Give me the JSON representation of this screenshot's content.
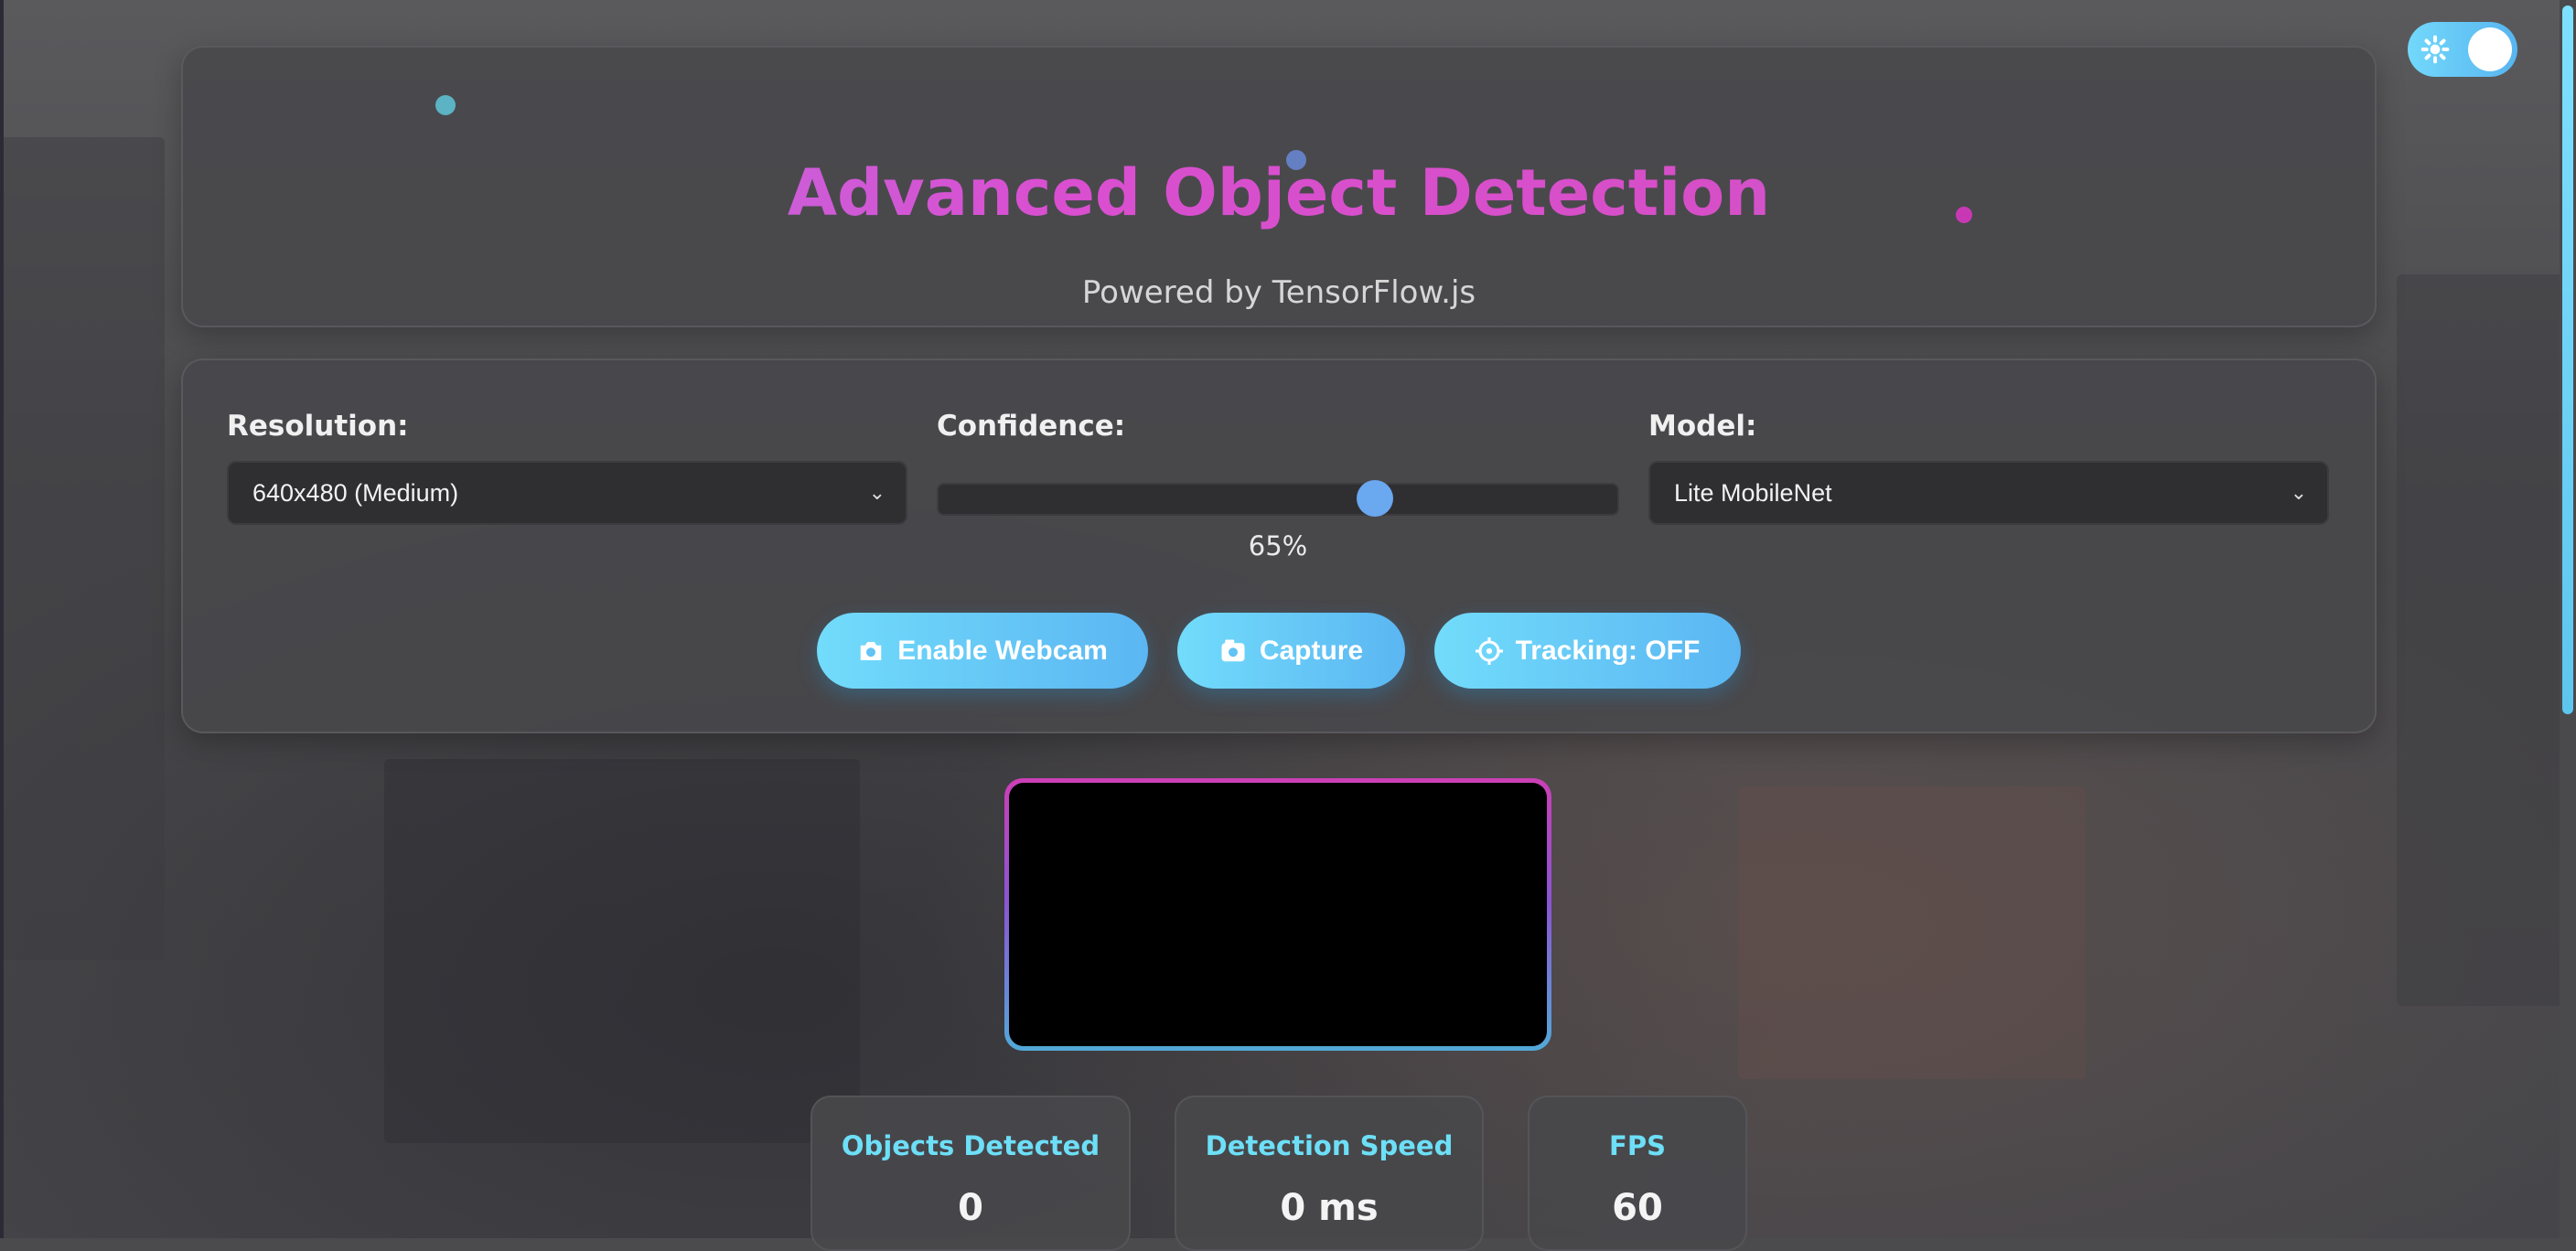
{
  "header": {
    "title": "Advanced Object Detection",
    "subtitle": "Powered by TensorFlow.js"
  },
  "controls": {
    "resolution": {
      "label": "Resolution:",
      "value": "640x480 (Medium)"
    },
    "confidence": {
      "label": "Confidence:",
      "value_text": "65%",
      "value": 0.65
    },
    "model": {
      "label": "Model:",
      "value": "Lite MobileNet"
    }
  },
  "buttons": {
    "webcam": "Enable Webcam",
    "capture": "Capture",
    "tracking": "Tracking: OFF"
  },
  "stats": [
    {
      "label": "Objects Detected",
      "value": "0"
    },
    {
      "label": "Detection Speed",
      "value": "0 ms"
    },
    {
      "label": "FPS",
      "value": "60"
    }
  ],
  "theme_toggle": {
    "state": "on",
    "icon": "gear-icon"
  },
  "colors": {
    "accent_cyan": "#72dcfb",
    "accent_blue": "#5bb6f2",
    "title_magenta": "#d94fd0",
    "title_purple": "#b27ae8",
    "stat_label": "#6ddff7"
  }
}
